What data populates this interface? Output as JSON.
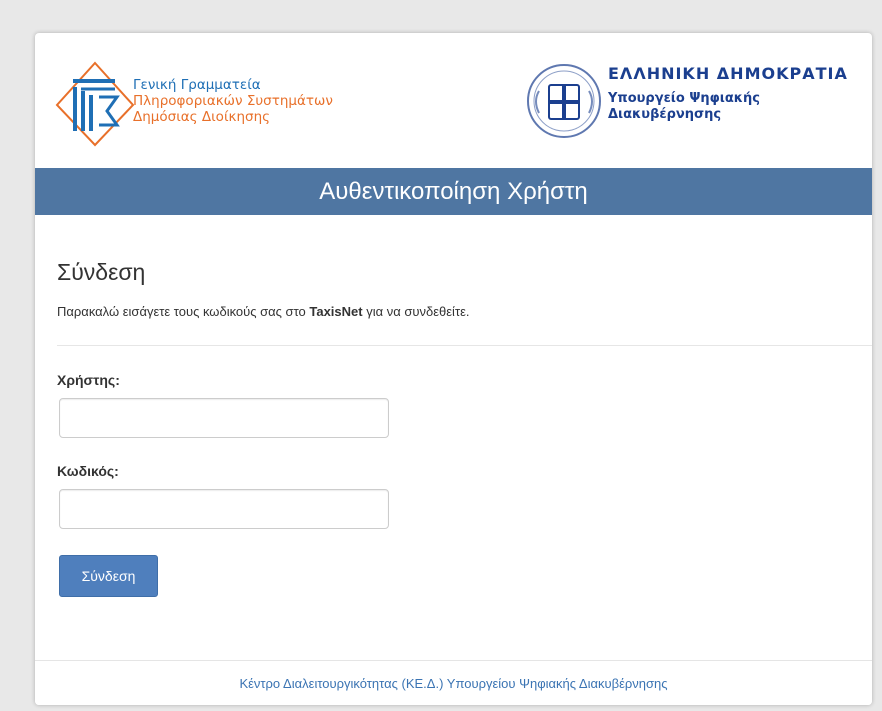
{
  "header": {
    "gsis_logo": {
      "line1": "Γενική Γραμματεία",
      "line2": "Πληροφοριακών Συστημάτων",
      "line3": "Δημόσιας Διοίκησης",
      "icon": "gsis-logo-icon"
    },
    "ministry": {
      "line1": "ΕΛΛΗΝΙΚΗ ΔΗΜΟΚΡΑΤΙΑ",
      "line2": "Υπουργείο Ψηφιακής",
      "line3": "Διακυβέρνησης",
      "icon": "greek-seal-icon"
    }
  },
  "banner": {
    "title": "Αυθεντικοποίηση Χρήστη"
  },
  "login": {
    "heading": "Σύνδεση",
    "intro_before": "Παρακαλώ εισάγετε τους κωδικούς σας στο ",
    "intro_bold": "TaxisNet",
    "intro_after": " για να συνδεθείτε.",
    "username_label": "Χρήστης:",
    "username_value": "",
    "password_label": "Κωδικός:",
    "password_value": "",
    "submit_label": "Σύνδεση"
  },
  "footer": {
    "link_text": "Κέντρο Διαλειτουργικότητας (ΚΕ.Δ.) Υπουργείου Ψηφιακής Διακυβέρνησης"
  },
  "colors": {
    "banner": "#4f76a2",
    "button": "#4f7fbd",
    "gsis_blue": "#1f6fb5",
    "gsis_orange": "#e8702a",
    "ministry_blue": "#1b3f8f",
    "footer_link": "#3b74b3"
  }
}
